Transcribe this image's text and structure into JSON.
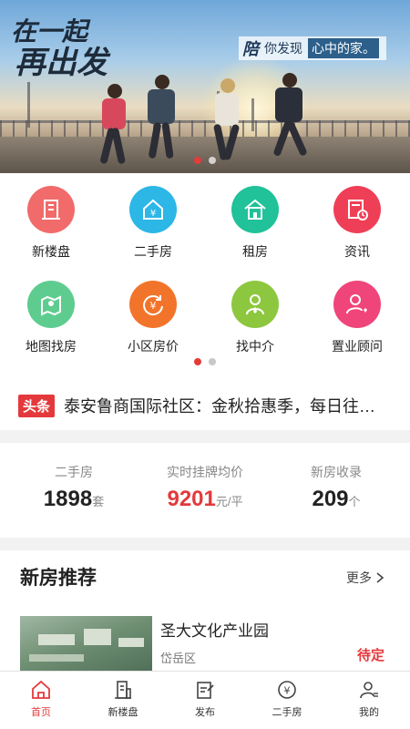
{
  "banner": {
    "slogan_line1": "在一起",
    "slogan_line2": "再出发",
    "tagline_big": "陪",
    "tagline_text": "你发现",
    "tagline_highlight": "心中的家。"
  },
  "menu": {
    "items": [
      {
        "label": "新楼盘",
        "icon": "building-icon",
        "color": "#f16b6b"
      },
      {
        "label": "二手房",
        "icon": "yuan-house-icon",
        "color": "#2cb7e6"
      },
      {
        "label": "租房",
        "icon": "house-icon",
        "color": "#21c19a"
      },
      {
        "label": "资讯",
        "icon": "news-clock-icon",
        "color": "#ef3f56"
      },
      {
        "label": "地图找房",
        "icon": "map-pin-icon",
        "color": "#5fcc8f"
      },
      {
        "label": "小区房价",
        "icon": "yuan-refresh-icon",
        "color": "#f2742b"
      },
      {
        "label": "找中介",
        "icon": "agent-icon",
        "color": "#8dc73f"
      },
      {
        "label": "置业顾问",
        "icon": "consultant-icon",
        "color": "#f0457a"
      }
    ]
  },
  "news": {
    "tag": "头条",
    "headline": "泰安鲁商国际社区：金秋拾惠季，每日往…"
  },
  "stats": [
    {
      "title": "二手房",
      "value": "1898",
      "unit": "套"
    },
    {
      "title": "实时挂牌均价",
      "value": "9201",
      "unit": "元/平"
    },
    {
      "title": "新房收录",
      "value": "209",
      "unit": "个"
    }
  ],
  "recommend": {
    "title": "新房推荐",
    "more": "更多",
    "item": {
      "name": "圣大文化产业园",
      "district": "岱岳区",
      "status": "待定"
    }
  },
  "tabbar": {
    "items": [
      {
        "label": "首页",
        "icon": "home-icon",
        "active": true
      },
      {
        "label": "新楼盘",
        "icon": "building-icon",
        "active": false
      },
      {
        "label": "发布",
        "icon": "publish-icon",
        "active": false
      },
      {
        "label": "二手房",
        "icon": "yuan-circle-icon",
        "active": false
      },
      {
        "label": "我的",
        "icon": "profile-icon",
        "active": false
      }
    ]
  },
  "colors": {
    "accent": "#e4393c",
    "tag": "#e4393c"
  }
}
